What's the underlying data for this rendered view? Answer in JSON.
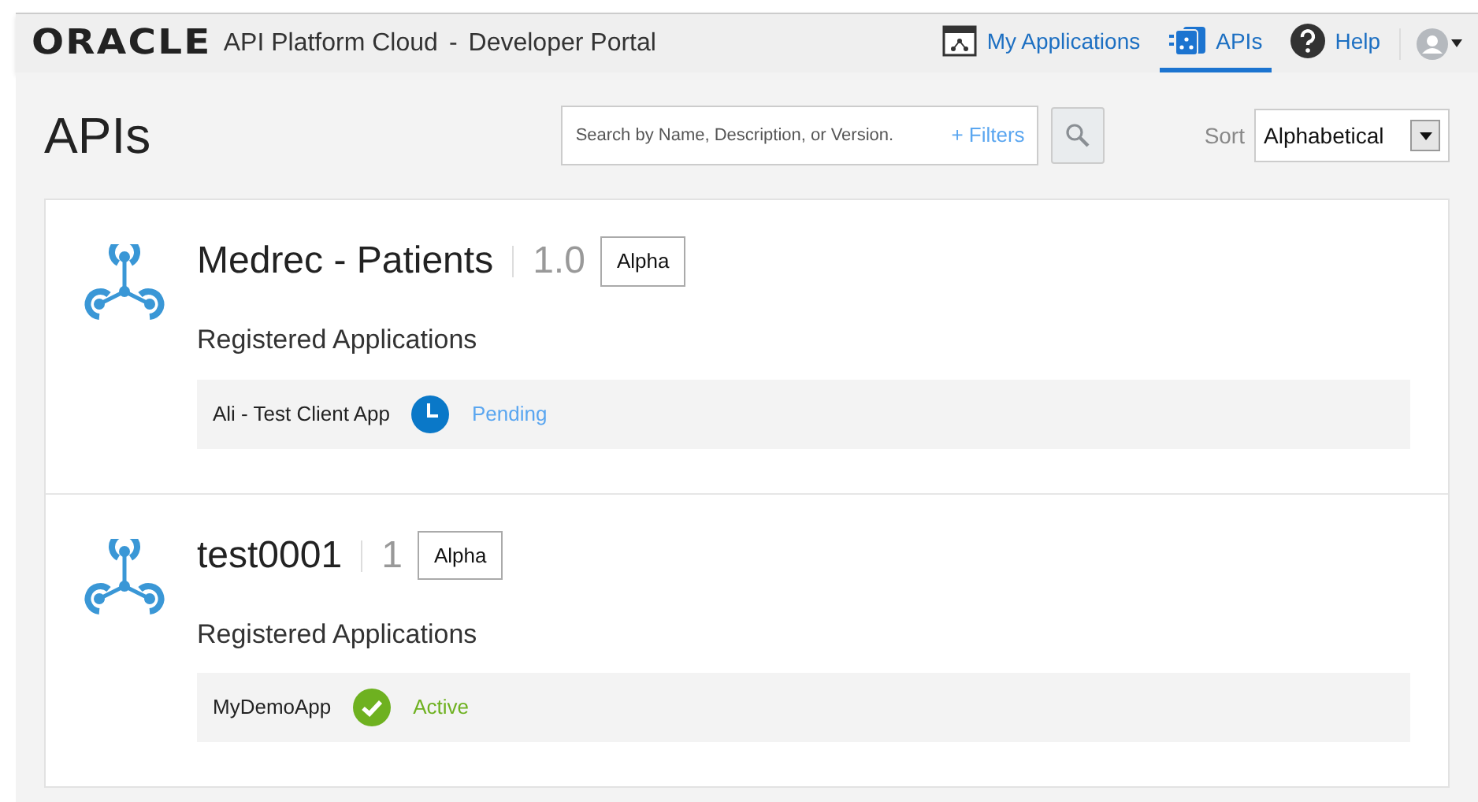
{
  "header": {
    "logo": "ORACLE",
    "product": "API Platform Cloud",
    "separator": "-",
    "portal": "Developer Portal"
  },
  "nav": [
    {
      "label": "My Applications",
      "kind": "apps",
      "selected": false
    },
    {
      "label": "APIs",
      "kind": "apis",
      "selected": true
    },
    {
      "label": "Help",
      "kind": "help",
      "selected": false
    }
  ],
  "page_title": "APIs",
  "search": {
    "placeholder": "Search by Name, Description, or Version.",
    "filters": "+ Filters"
  },
  "sort": {
    "label": "Sort",
    "value": "Alphabetical"
  },
  "apis": [
    {
      "name": "Medrec - Patients",
      "version": "1.0",
      "tag": "Alpha",
      "section_title": "Registered Applications",
      "applications": [
        {
          "name": "Ali - Test Client App",
          "status": "Pending",
          "kind": "pending"
        }
      ]
    },
    {
      "name": "test0001",
      "version": "1",
      "tag": "Alpha",
      "section_title": "Registered Applications",
      "applications": [
        {
          "name": "MyDemoApp",
          "status": "Active",
          "kind": "active"
        }
      ]
    }
  ]
}
